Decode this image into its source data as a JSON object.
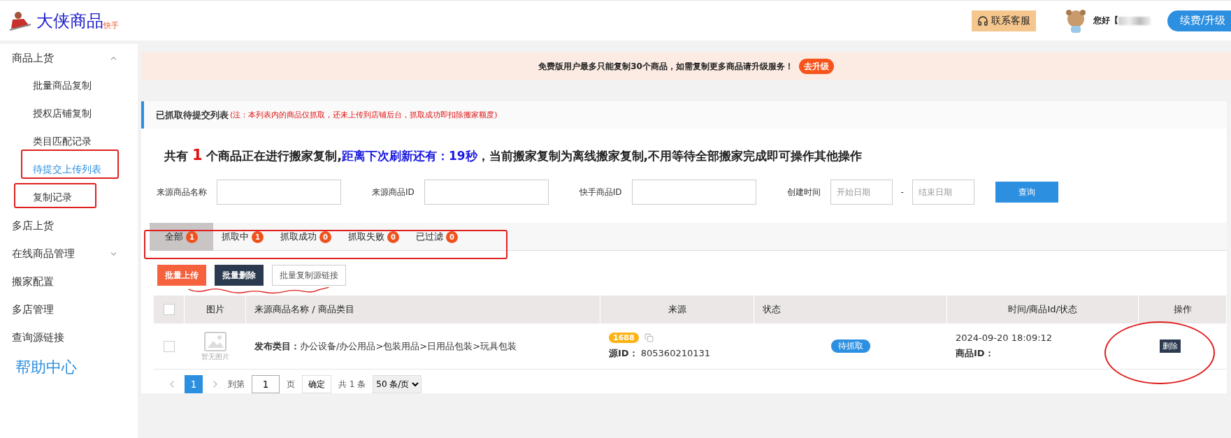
{
  "header": {
    "brand": "大侠商品",
    "brand_sub": "快手",
    "service_button": "联系客服",
    "greeting": "您好【",
    "upgrade_button": "续费/升级"
  },
  "sidebar": {
    "items": [
      {
        "label": "商品上货",
        "expanded": true,
        "selected": false,
        "children": [
          {
            "label": "批量商品复制",
            "selected": false
          },
          {
            "label": "授权店铺复制",
            "selected": false
          },
          {
            "label": "类目匹配记录",
            "selected": false
          },
          {
            "label": "待提交上传列表",
            "selected": true
          },
          {
            "label": "复制记录",
            "selected": false
          }
        ]
      },
      {
        "label": "多店上货",
        "selected": false
      },
      {
        "label": "在线商品管理",
        "expanded": false,
        "selected": false
      },
      {
        "label": "搬家配置",
        "selected": false
      },
      {
        "label": "多店管理",
        "selected": false
      },
      {
        "label": "查询源链接",
        "selected": false
      }
    ],
    "help": "帮助中心"
  },
  "banner": {
    "text": "免费版用户最多只能复制30个商品，如需复制更多商品请升级服务！",
    "button": "去升级"
  },
  "notice": {
    "title": "已抓取待提交列表",
    "note": "(注：本列表内的商品仅抓取，还未上传到店铺后台，抓取成功即扣除搬家额度)"
  },
  "summary": [
    {
      "kind": "plain",
      "text": "共有 "
    },
    {
      "kind": "count",
      "text": "1"
    },
    {
      "kind": "plain",
      "text": " 个商品正在进行搬家复制,"
    },
    {
      "kind": "highlight",
      "text": "距离下次刷新还有：19秒"
    },
    {
      "kind": "plain",
      "text": "，当前搬家复制为离线搬家复制,不用等待全部搬家完成即可操作其他操作"
    }
  ],
  "filters": [
    {
      "kind": "text",
      "label": "来源商品名称"
    },
    {
      "kind": "text",
      "label": "来源商品ID"
    },
    {
      "kind": "text",
      "label": "快手商品ID"
    },
    {
      "kind": "daterange",
      "label": "创建时间",
      "start_placeholder": "开始日期",
      "separator": "-",
      "end_placeholder": "结束日期"
    }
  ],
  "query_button": "查询",
  "tabs": [
    {
      "label": "全部",
      "count": "1",
      "selected": true
    },
    {
      "label": "抓取中",
      "count": "1",
      "selected": false
    },
    {
      "label": "抓取成功",
      "count": "0",
      "selected": false
    },
    {
      "label": "抓取失败",
      "count": "0",
      "selected": false
    },
    {
      "label": "已过滤",
      "count": "0",
      "selected": false
    }
  ],
  "actions": [
    {
      "kind": "primary",
      "label": "批量上传"
    },
    {
      "kind": "dark",
      "label": "批量删除"
    },
    {
      "kind": "outline",
      "label": "批量复制源链接"
    }
  ],
  "table": {
    "columns": [
      "图片",
      "来源商品名称 / 商品类目",
      "来源",
      "状态",
      "时间/商品Id/状态",
      "操作"
    ],
    "header_checked": false,
    "rows": [
      {
        "checked": false,
        "image_caption": "暂无图片",
        "category_label": "发布类目：",
        "category": "办公设备/办公用品>包装用品>日用品包装>玩具包装",
        "source_tag": "1688",
        "source_id_label": "源ID：",
        "source_id": "805360210131",
        "status": "待抓取",
        "time": "2024-09-20 18:09:12",
        "product_id_label": "商品ID：",
        "action": "删除"
      }
    ]
  },
  "pagination": {
    "pages": [
      {
        "label": "1",
        "selected": true
      }
    ],
    "goto_label": "到第",
    "goto_value": "1",
    "page_unit": "页",
    "confirm": "确定",
    "total": "共 1 条",
    "page_size": "50 条/页"
  }
}
